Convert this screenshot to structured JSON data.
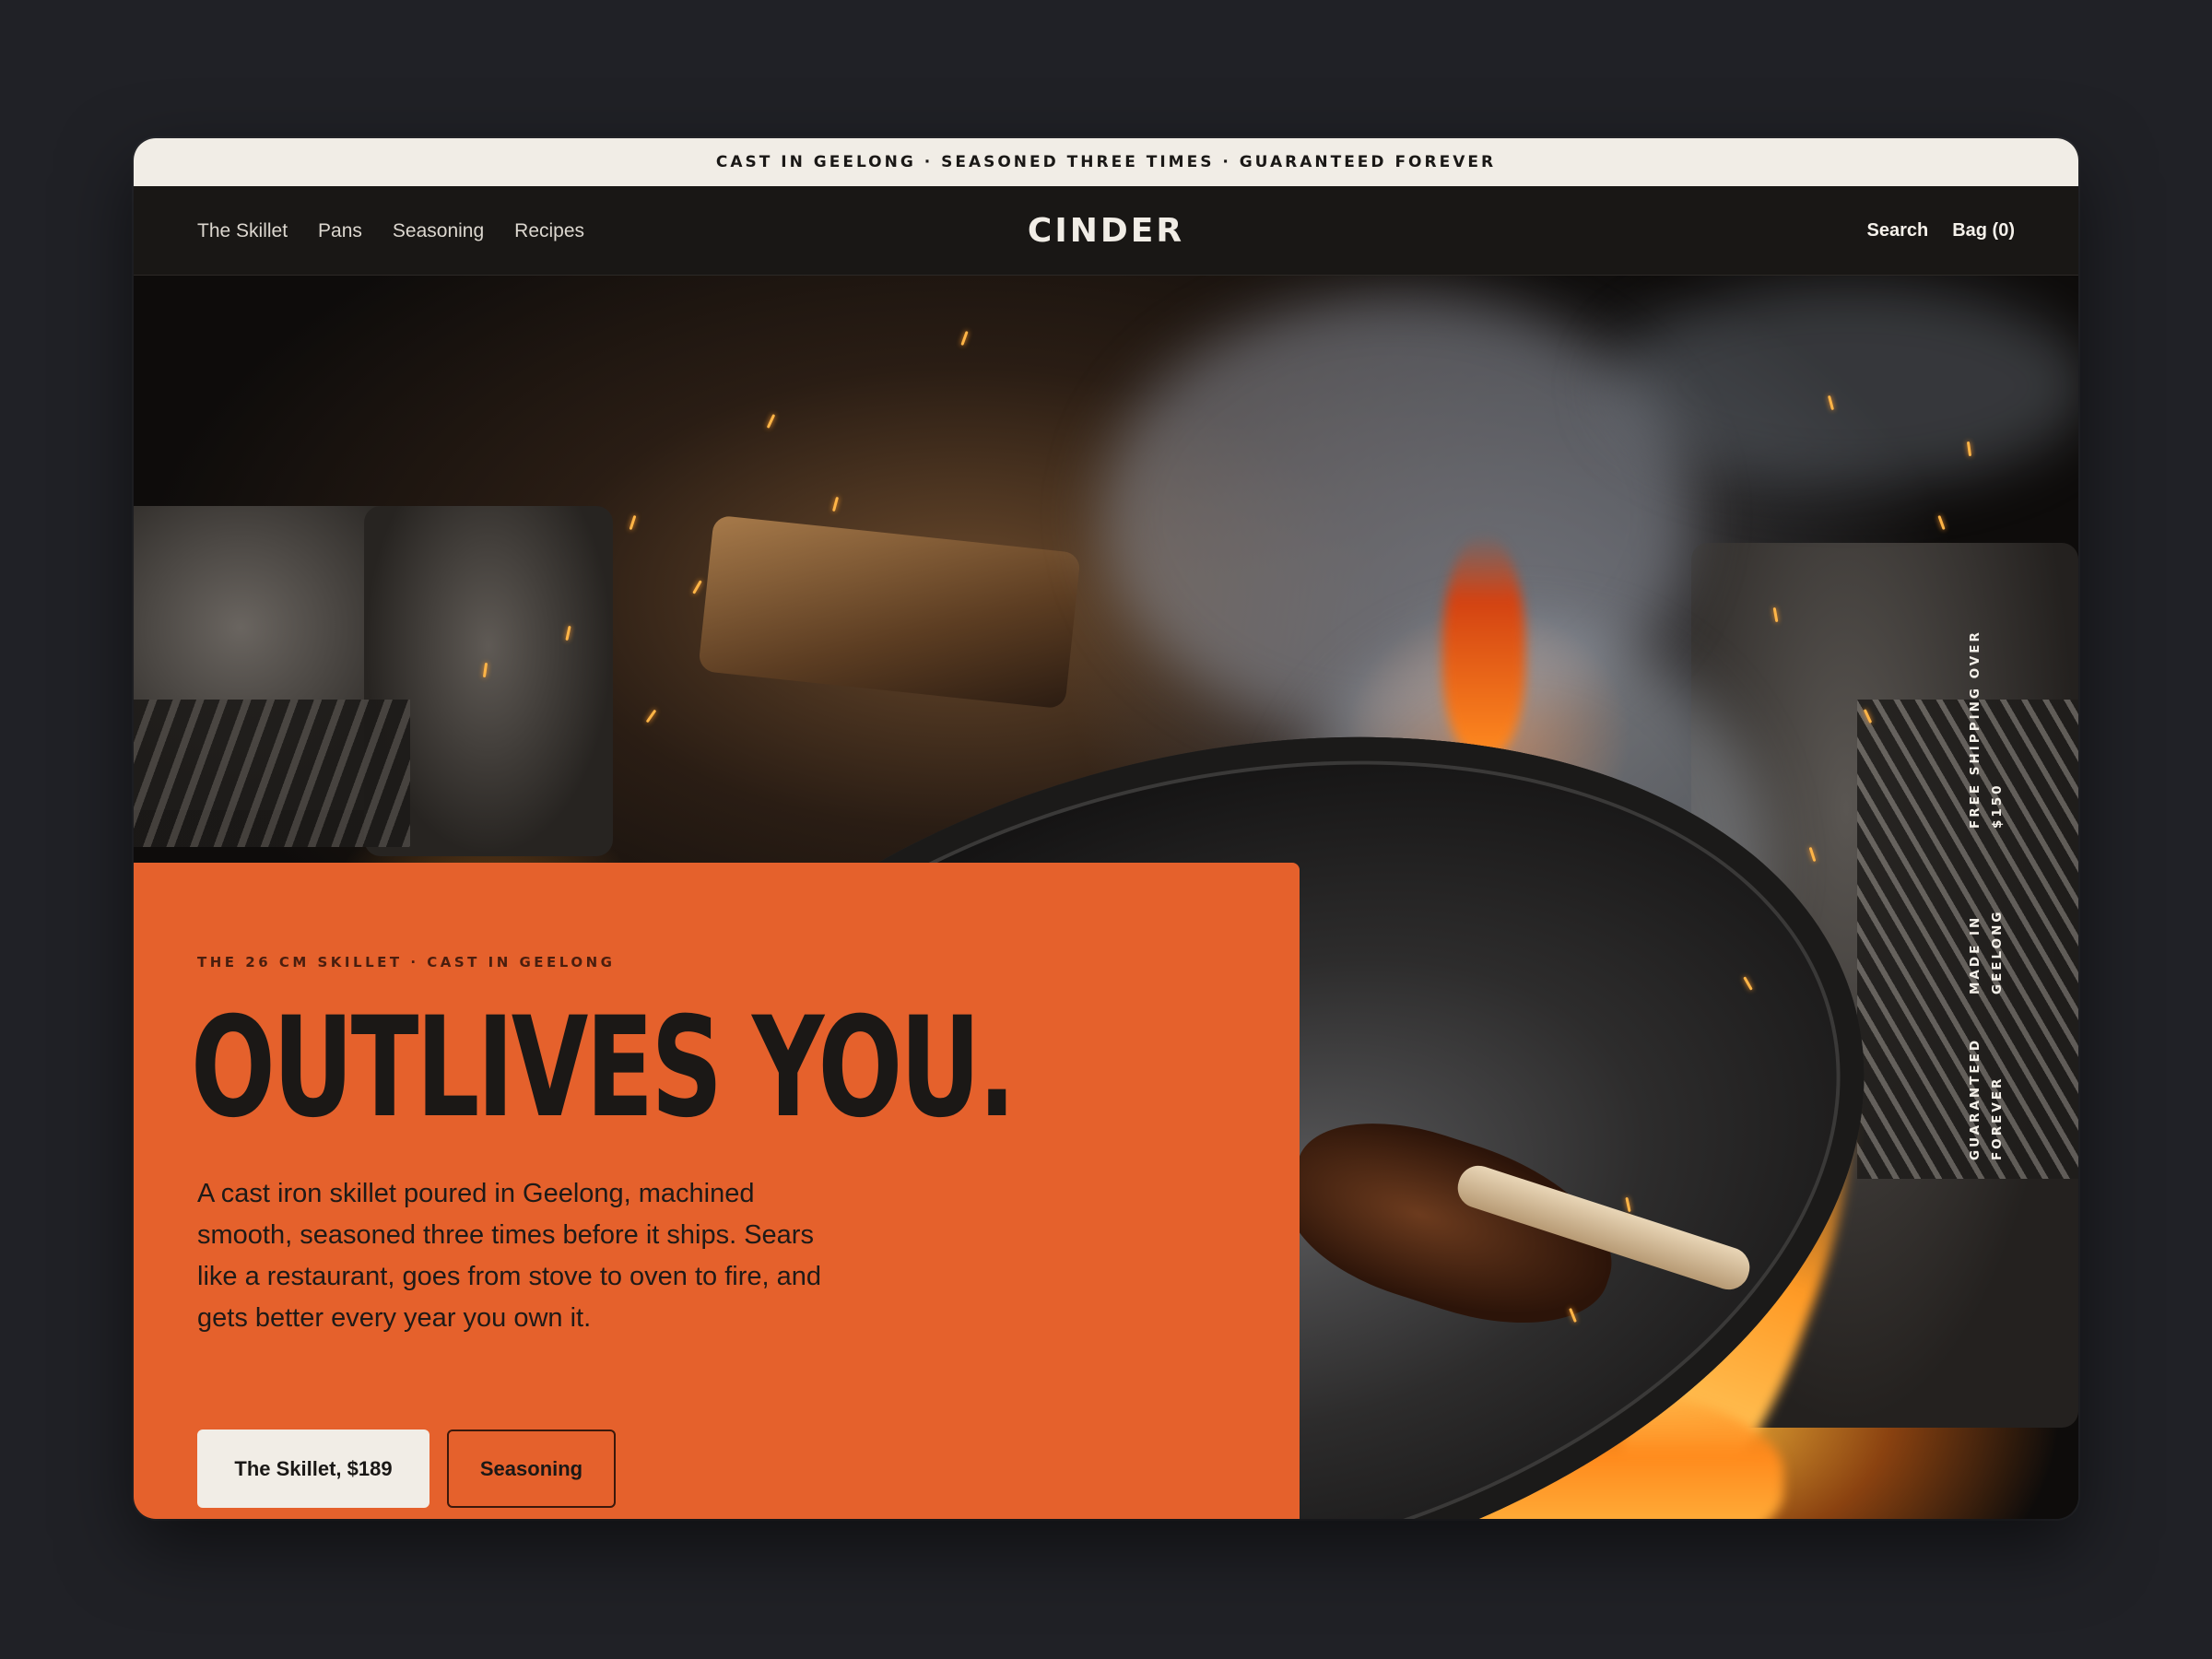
{
  "announcement": "CAST IN GEELONG · SEASONED THREE TIMES · GUARANTEED FOREVER",
  "nav": {
    "links": [
      "The Skillet",
      "Pans",
      "Seasoning",
      "Recipes"
    ],
    "brand": "CINDER",
    "search_label": "Search",
    "bag_label": "Bag (0)"
  },
  "side_badges": [
    "FREE SHIPPING OVER $150",
    "MADE IN GEELONG",
    "GUARANTEED FOREVER"
  ],
  "hero": {
    "eyebrow": "THE 26 CM SKILLET · CAST IN GEELONG",
    "headline": "OUTLIVES YOU.",
    "body": "A cast iron skillet poured in Geelong, machined smooth, seasoned three times before it ships. Sears like a restaurant, goes from stove to oven to fire, and gets better every year you own it.",
    "primary_cta": "The Skillet, $189",
    "secondary_cta": "Seasoning"
  },
  "colors": {
    "accent": "#e5612c",
    "page_bg": "#202126",
    "nav_bg": "#191715",
    "banner_bg": "#f1ede6"
  }
}
